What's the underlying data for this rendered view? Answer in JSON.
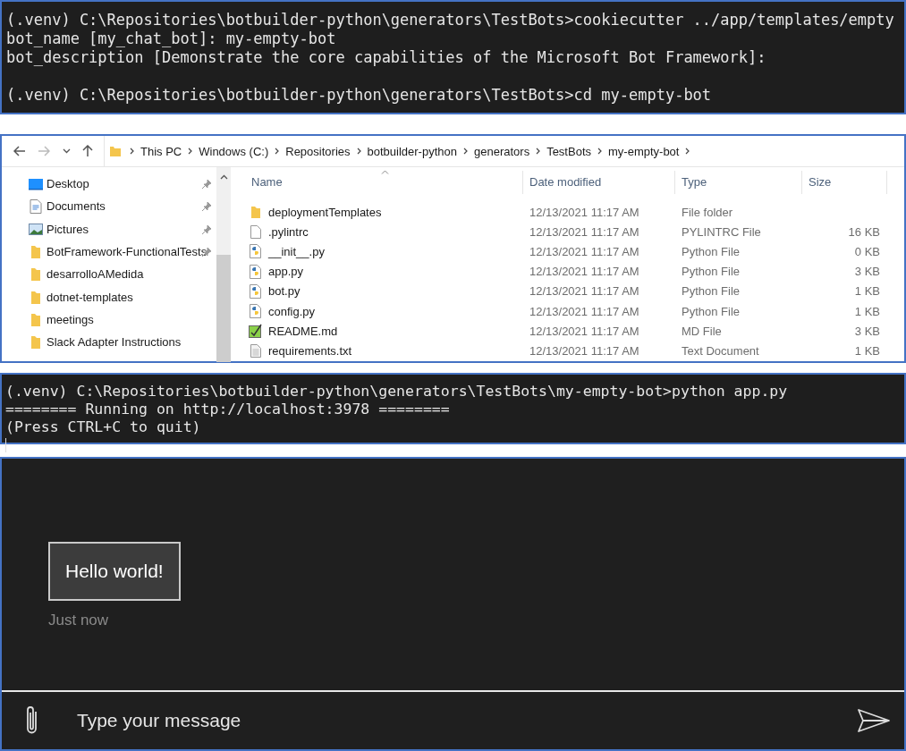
{
  "terminal_top": {
    "lines": [
      {
        "text": "(.venv) C:\\Repositories\\botbuilder-python\\generators\\TestBots>cookiecutter ../app/templates/empty",
        "spaced": false
      },
      {
        "text": "bot_name [my_chat_bot]: my-empty-bot",
        "spaced": false
      },
      {
        "text": "bot_description [Demonstrate the core capabilities of the Microsoft Bot Framework]:",
        "spaced": false
      },
      {
        "text": "(.venv) C:\\Repositories\\botbuilder-python\\generators\\TestBots>cd my-empty-bot",
        "spaced": true
      }
    ]
  },
  "explorer": {
    "breadcrumb": [
      "This PC",
      "Windows (C:)",
      "Repositories",
      "botbuilder-python",
      "generators",
      "TestBots",
      "my-empty-bot"
    ],
    "sidebar": {
      "items": [
        {
          "label": "Desktop",
          "kind": "desktop",
          "pinned": true
        },
        {
          "label": "Documents",
          "kind": "documents",
          "pinned": true
        },
        {
          "label": "Pictures",
          "kind": "pictures",
          "pinned": true
        },
        {
          "label": "BotFramework-FunctionalTests",
          "kind": "folder",
          "pinned": true
        },
        {
          "label": "desarrolloAMedida",
          "kind": "folder",
          "pinned": false
        },
        {
          "label": "dotnet-templates",
          "kind": "folder",
          "pinned": false
        },
        {
          "label": "meetings",
          "kind": "folder",
          "pinned": false
        },
        {
          "label": "Slack Adapter Instructions",
          "kind": "folder",
          "pinned": false
        }
      ]
    },
    "columns": [
      "Name",
      "Date modified",
      "Type",
      "Size"
    ],
    "files": [
      {
        "name": "deploymentTemplates",
        "kind": "folder",
        "date": "12/13/2021 11:17 AM",
        "type": "File folder"
      },
      {
        "name": ".pylintrc",
        "kind": "file",
        "date": "12/13/2021 11:17 AM",
        "type": "PYLINTRC File",
        "size": "16 KB"
      },
      {
        "name": "__init__.py",
        "kind": "python",
        "date": "12/13/2021 11:17 AM",
        "type": "Python File",
        "size": "0 KB"
      },
      {
        "name": "app.py",
        "kind": "python",
        "date": "12/13/2021 11:17 AM",
        "type": "Python File",
        "size": "3 KB"
      },
      {
        "name": "bot.py",
        "kind": "python",
        "date": "12/13/2021 11:17 AM",
        "type": "Python File",
        "size": "1 KB"
      },
      {
        "name": "config.py",
        "kind": "python",
        "date": "12/13/2021 11:17 AM",
        "type": "Python File",
        "size": "1 KB"
      },
      {
        "name": "README.md",
        "kind": "markdown",
        "date": "12/13/2021 11:17 AM",
        "type": "MD File",
        "size": "3 KB"
      },
      {
        "name": "requirements.txt",
        "kind": "text",
        "date": "12/13/2021 11:17 AM",
        "type": "Text Document",
        "size": "1 KB"
      }
    ]
  },
  "terminal_bottom": {
    "lines": [
      {
        "text": "(.venv) C:\\Repositories\\botbuilder-python\\generators\\TestBots\\my-empty-bot>python app.py"
      },
      {
        "text": "======== Running on http://localhost:3978 ========"
      },
      {
        "text": "(Press CTRL+C to quit)"
      }
    ]
  },
  "chat": {
    "messages": [
      {
        "text": "Hello world!",
        "time": "Just now"
      }
    ],
    "input": {
      "placeholder": "Type your message"
    }
  }
}
